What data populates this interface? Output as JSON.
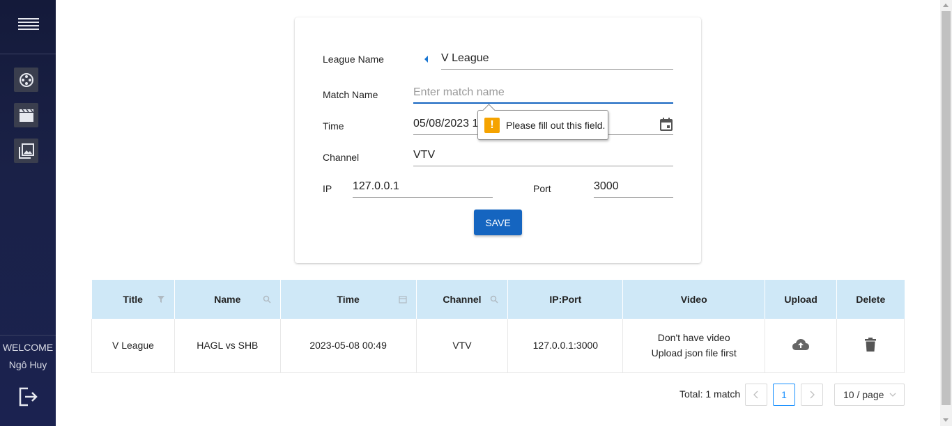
{
  "sidebar": {
    "icons": [
      "film-reel-icon",
      "clapperboard-icon",
      "gallery-icon"
    ],
    "welcome": "WELCOME",
    "user": "Ngô Huy"
  },
  "form": {
    "league_label": "League Name",
    "league_value": "V League",
    "match_label": "Match Name",
    "match_placeholder": "Enter match name",
    "time_label": "Time",
    "time_value": "05/08/2023 1",
    "channel_label": "Channel",
    "channel_value": "VTV",
    "ip_label": "IP",
    "ip_value": "127.0.0.1",
    "port_label": "Port",
    "port_value": "3000",
    "save_label": "SAVE"
  },
  "tooltip": {
    "icon": "!",
    "text": "Please fill out this field."
  },
  "table": {
    "headers": [
      "Title",
      "Name",
      "Time",
      "Channel",
      "IP:Port",
      "Video",
      "Upload",
      "Delete"
    ],
    "rows": [
      {
        "title": "V League",
        "name": "HAGL vs SHB",
        "time": "2023-05-08 00:49",
        "channel": "VTV",
        "ipport": "127.0.0.1:3000",
        "video_line1": "Don't have video",
        "video_line2": "Upload json file first"
      }
    ]
  },
  "pagination": {
    "total": "Total: 1 match",
    "current_page": "1",
    "per_page": "10 / page"
  },
  "colors": {
    "sidebar": "#1a2147",
    "primary": "#1565c0",
    "table_header": "#cfe8f7",
    "warning": "#f5a300"
  }
}
